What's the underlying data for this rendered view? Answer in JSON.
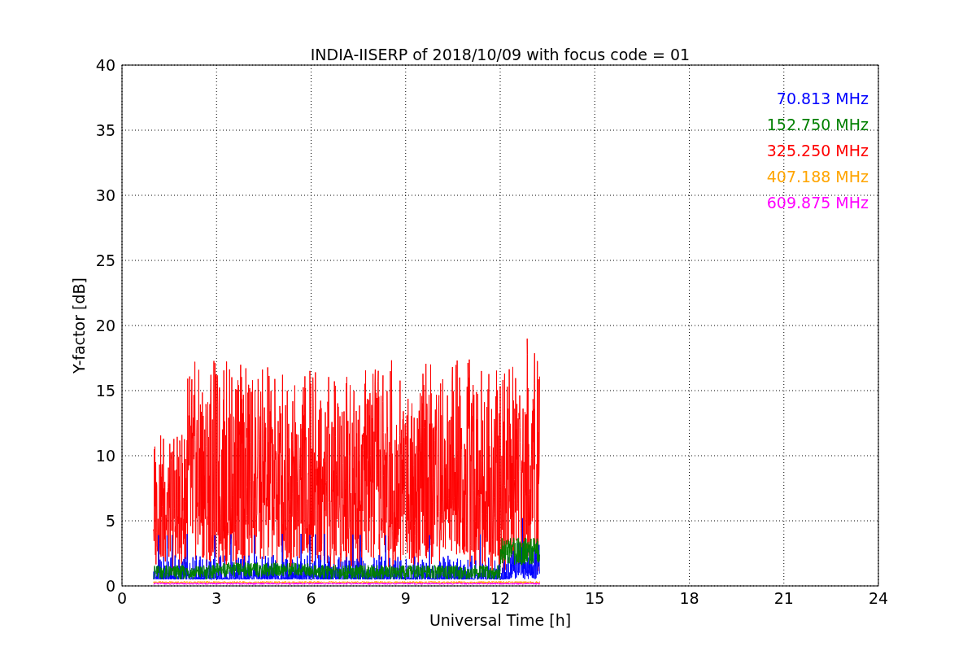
{
  "figure": {
    "title": "INDIA-IISERP of 2018/10/09 with focus code = 01",
    "xlabel": "Universal Time [h]",
    "ylabel": "Y-factor [dB]",
    "xtick_labels": [
      "0",
      "3",
      "6",
      "9",
      "12",
      "15",
      "18",
      "21",
      "24"
    ],
    "ytick_labels": [
      "40",
      "35",
      "30",
      "25",
      "20",
      "15",
      "10",
      "5",
      "0"
    ],
    "series": [
      {
        "label": "70.813 MHz",
        "color": "#0000ff"
      },
      {
        "label": "152.750 MHz",
        "color": "#008000"
      },
      {
        "label": "325.250 MHz",
        "color": "#ff0000"
      },
      {
        "label": "407.188 MHz",
        "color": "#ffa500"
      },
      {
        "label": "609.875 MHz",
        "color": "#ff00ff"
      }
    ]
  }
}
